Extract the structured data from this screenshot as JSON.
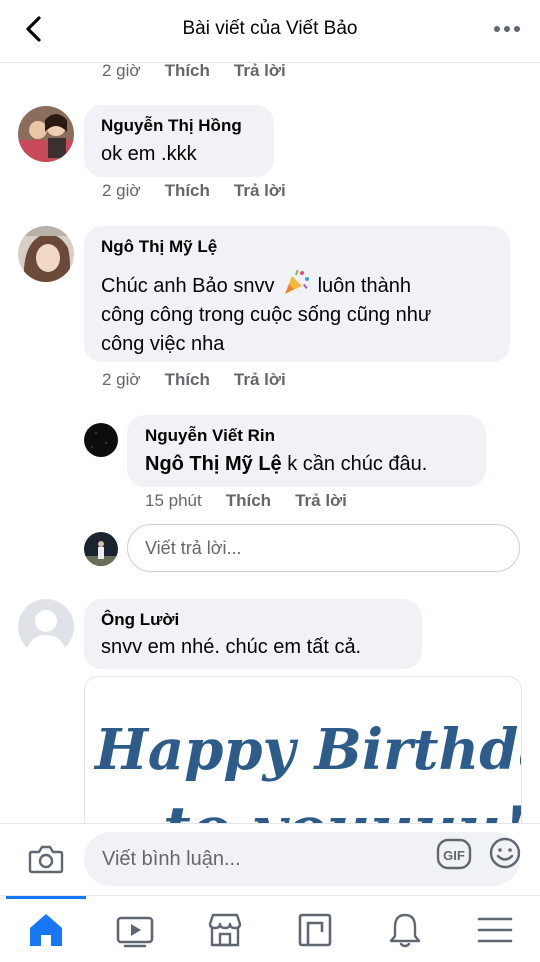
{
  "header": {
    "title": "Bài viết của Viết Bảo"
  },
  "actions": {
    "like": "Thích",
    "reply": "Trả lời"
  },
  "comments": [
    {
      "time": "2 giờ"
    },
    {
      "name": "Nguyễn Thị Hồng",
      "text": "ok em .kkk",
      "time": "2 giờ"
    },
    {
      "name": "Ngô Thị Mỹ Lệ",
      "text_line1_before": "Chúc anh Bảo snvv",
      "text_line1_after": "luôn thành",
      "text_line2": "công công trong cuộc sống cũng như",
      "text_line3": "công việc nha",
      "time": "2 giờ"
    },
    {
      "name": "Nguyễn Viết Rin",
      "mention": "Ngô Thị Mỹ Lệ",
      "text": " k cần chúc đâu.",
      "time": "15 phút"
    },
    {
      "name": "Ông Lười",
      "text": "snvv em nhé. chúc em tất cả."
    }
  ],
  "reply_input": {
    "placeholder": "Viết trả lời..."
  },
  "card": {
    "line1": "Happy Birthday",
    "line2": "to youuuu!"
  },
  "composer": {
    "placeholder": "Viết bình luận...",
    "gif_label": "GIF"
  },
  "tabs": [
    "home-icon",
    "video-icon",
    "marketplace-icon",
    "pages-icon",
    "notifications-icon",
    "menu-icon"
  ],
  "colors": {
    "accent": "#1877f2",
    "bubble": "#f0f2f5",
    "meta": "#65676b",
    "card_text": "#2e5c8a"
  }
}
